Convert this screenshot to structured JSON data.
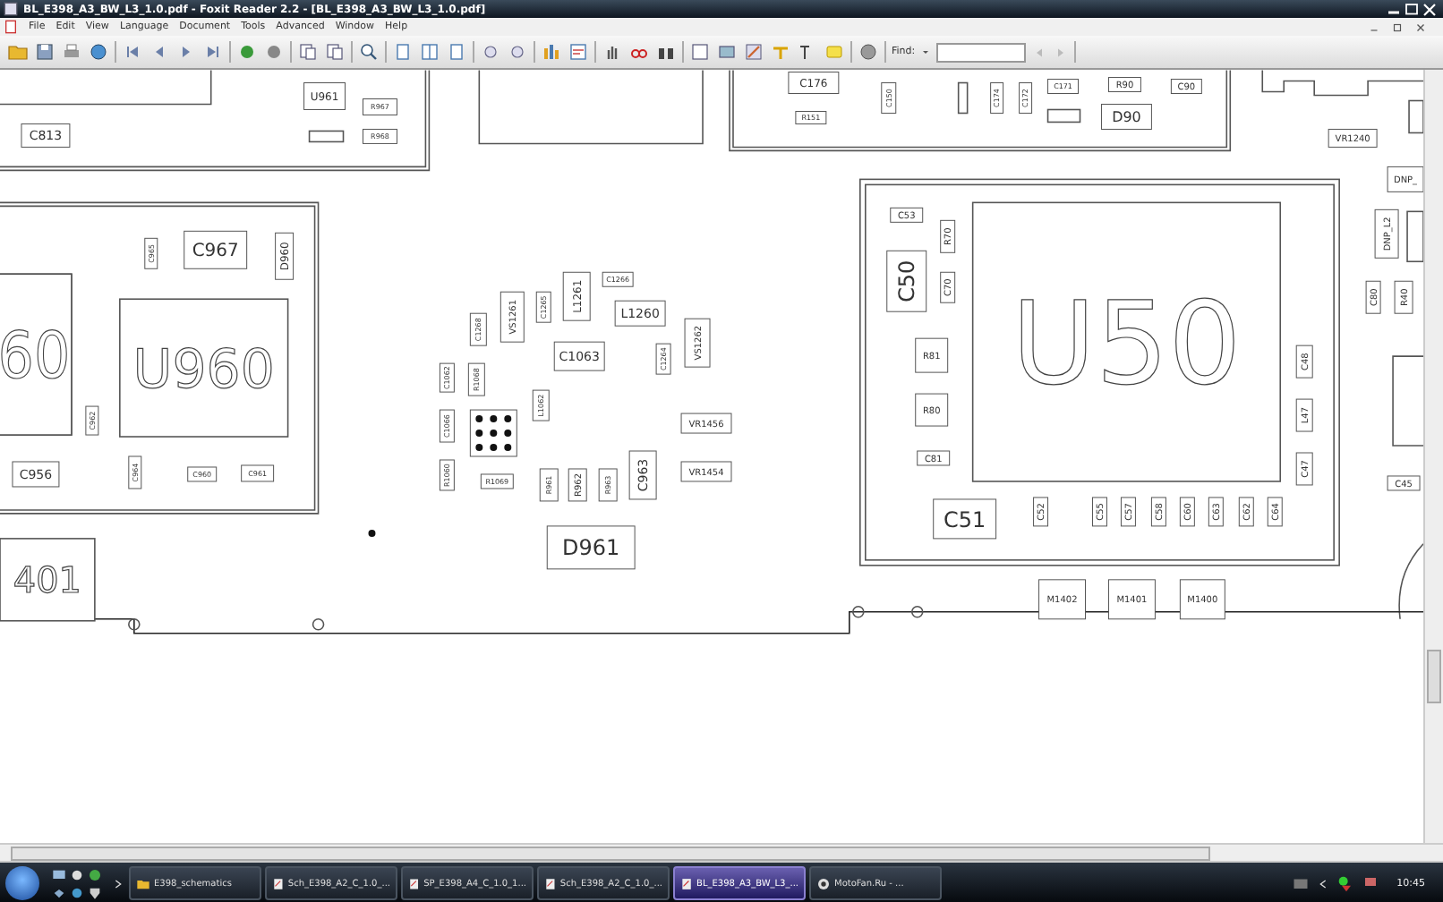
{
  "window": {
    "title": "BL_E398_A3_BW_L3_1.0.pdf - Foxit Reader 2.2 - [BL_E398_A3_BW_L3_1.0.pdf]"
  },
  "menu": [
    {
      "label": "File"
    },
    {
      "label": "Edit"
    },
    {
      "label": "View"
    },
    {
      "label": "Language"
    },
    {
      "label": "Document"
    },
    {
      "label": "Tools"
    },
    {
      "label": "Advanced"
    },
    {
      "label": "Window"
    },
    {
      "label": "Help"
    }
  ],
  "find": {
    "label": "Find:"
  },
  "board": {
    "parts": [
      {
        "label": "U961"
      },
      {
        "label": "R967"
      },
      {
        "label": "C813"
      },
      {
        "label": "R968"
      },
      {
        "label": "C965"
      },
      {
        "label": "C967"
      },
      {
        "label": "D960"
      },
      {
        "label": "60"
      },
      {
        "label": "U960"
      },
      {
        "label": "C962"
      },
      {
        "label": "C956"
      },
      {
        "label": "C964"
      },
      {
        "label": "C960"
      },
      {
        "label": "C961"
      },
      {
        "label": "401"
      },
      {
        "label": "VS1261"
      },
      {
        "label": "C1265"
      },
      {
        "label": "L1261"
      },
      {
        "label": "C1266"
      },
      {
        "label": "L1260"
      },
      {
        "label": "C1268"
      },
      {
        "label": "C1063"
      },
      {
        "label": "C1264"
      },
      {
        "label": "VS1262"
      },
      {
        "label": "C1062"
      },
      {
        "label": "R1068"
      },
      {
        "label": "L1062"
      },
      {
        "label": "C1066"
      },
      {
        "label": "R1060"
      },
      {
        "label": "R1069"
      },
      {
        "label": "R961"
      },
      {
        "label": "R962"
      },
      {
        "label": "R963"
      },
      {
        "label": "C963"
      },
      {
        "label": "VR1456"
      },
      {
        "label": "VR1454"
      },
      {
        "label": "D961"
      },
      {
        "label": "C176"
      },
      {
        "label": "R151"
      },
      {
        "label": "C150"
      },
      {
        "label": "C174"
      },
      {
        "label": "C172"
      },
      {
        "label": "C171"
      },
      {
        "label": "R90"
      },
      {
        "label": "C90"
      },
      {
        "label": "D90"
      },
      {
        "label": "VR1240"
      },
      {
        "label": "DNP_"
      },
      {
        "label": "DNP_L2"
      },
      {
        "label": "C80"
      },
      {
        "label": "R40"
      },
      {
        "label": "C45"
      },
      {
        "label": "U50"
      },
      {
        "label": "C53"
      },
      {
        "label": "R70"
      },
      {
        "label": "C50"
      },
      {
        "label": "C70"
      },
      {
        "label": "R81"
      },
      {
        "label": "R80"
      },
      {
        "label": "C81"
      },
      {
        "label": "C51"
      },
      {
        "label": "C52"
      },
      {
        "label": "C55"
      },
      {
        "label": "C57"
      },
      {
        "label": "C58"
      },
      {
        "label": "C60"
      },
      {
        "label": "C63"
      },
      {
        "label": "C62"
      },
      {
        "label": "C64"
      },
      {
        "label": "C48"
      },
      {
        "label": "L47"
      },
      {
        "label": "C47"
      },
      {
        "label": "M1402"
      },
      {
        "label": "M1401"
      },
      {
        "label": "M1400"
      }
    ]
  },
  "taskbar": {
    "buttons": [
      {
        "label": "E398_schematics",
        "kind": "folder",
        "selected": false
      },
      {
        "label": "Sch_E398_A2_C_1.0_...",
        "kind": "document",
        "selected": false
      },
      {
        "label": "SP_E398_A4_C_1.0_1...",
        "kind": "document",
        "selected": false
      },
      {
        "label": "Sch_E398_A2_C_1.0_...",
        "kind": "document",
        "selected": false
      },
      {
        "label": "BL_E398_A3_BW_L3_...",
        "kind": "document",
        "selected": true
      },
      {
        "label": "MotoFan.Ru - ...",
        "kind": "browser",
        "selected": false
      }
    ],
    "clock": "10:45"
  }
}
